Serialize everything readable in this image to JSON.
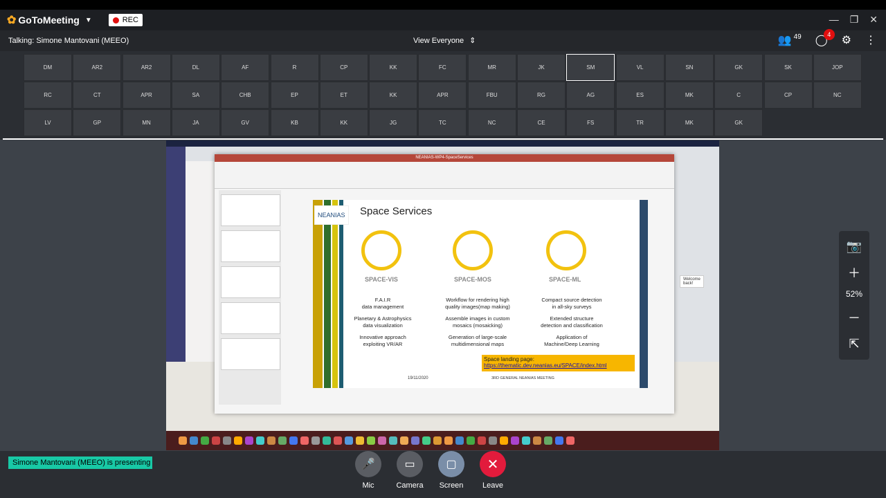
{
  "app": {
    "name": "GoToMeeting",
    "rec_label": "REC"
  },
  "window_controls": [
    "—",
    "❐",
    "✕"
  ],
  "talking": "Talking: Simone Mantovani (MEEO)",
  "view_mode": "View Everyone",
  "attendee_count": "49",
  "chat_badge": "4",
  "participants_row1": [
    "DM",
    "AR2",
    "AR2",
    "DL",
    "AF",
    "R",
    "CP",
    "KK",
    "FC",
    "MR",
    "JK",
    "SM",
    "VL",
    "SN",
    "GK",
    "SK",
    "JOP"
  ],
  "participants_row2": [
    "RC",
    "CT",
    "APR",
    "SA",
    "CHB",
    "EP",
    "ET",
    "KK",
    "APR",
    "FBU",
    "RG",
    "AG",
    "ES",
    "MK",
    "C",
    "CP",
    "NC"
  ],
  "participants_row3": [
    "LV",
    "GP",
    "MN",
    "JA",
    "GV",
    "KB",
    "KK",
    "JG",
    "TC",
    "NC",
    "CE",
    "FS",
    "TR",
    "MK",
    "GK"
  ],
  "active_tile": "SM",
  "ppt": {
    "window_title": "NEANIAS-WP4-SpaceServices",
    "slide": {
      "logo_text": "NEANIAS",
      "title": "Space Services",
      "services": [
        {
          "name": "SPACE-VIS",
          "lines": [
            "F.A.I.R",
            "data management",
            "Planetary & Astrophysics",
            "data visualization",
            "Innovative approach",
            "exploiting VR/AR"
          ]
        },
        {
          "name": "SPACE-MOS",
          "lines": [
            "Workflow for rendering high",
            "quality images(map making)",
            "Assemble images in custom",
            "mosaics (mosaicking)",
            "Generation of large-scale",
            "multidimensional maps"
          ]
        },
        {
          "name": "SPACE-ML",
          "lines": [
            "Compact source detection",
            "in all-sky surveys",
            "Extended structure",
            "detection and classification",
            "Application of",
            "Machine/Deep Learning"
          ]
        }
      ],
      "landing_label": "Space landing page:",
      "landing_url": "https://thematic.dev.neanias.eu/SPACE/index.html",
      "date": "19/11/2020",
      "meeting": "3RD GENERAL NEANIAS MEETING"
    },
    "welcome": "Welcome back!"
  },
  "zoom": {
    "percent": "52%"
  },
  "presenting": "Simone Mantovani (MEEO) is presenting",
  "controls": {
    "mic": "Mic",
    "camera": "Camera",
    "screen": "Screen",
    "leave": "Leave"
  }
}
